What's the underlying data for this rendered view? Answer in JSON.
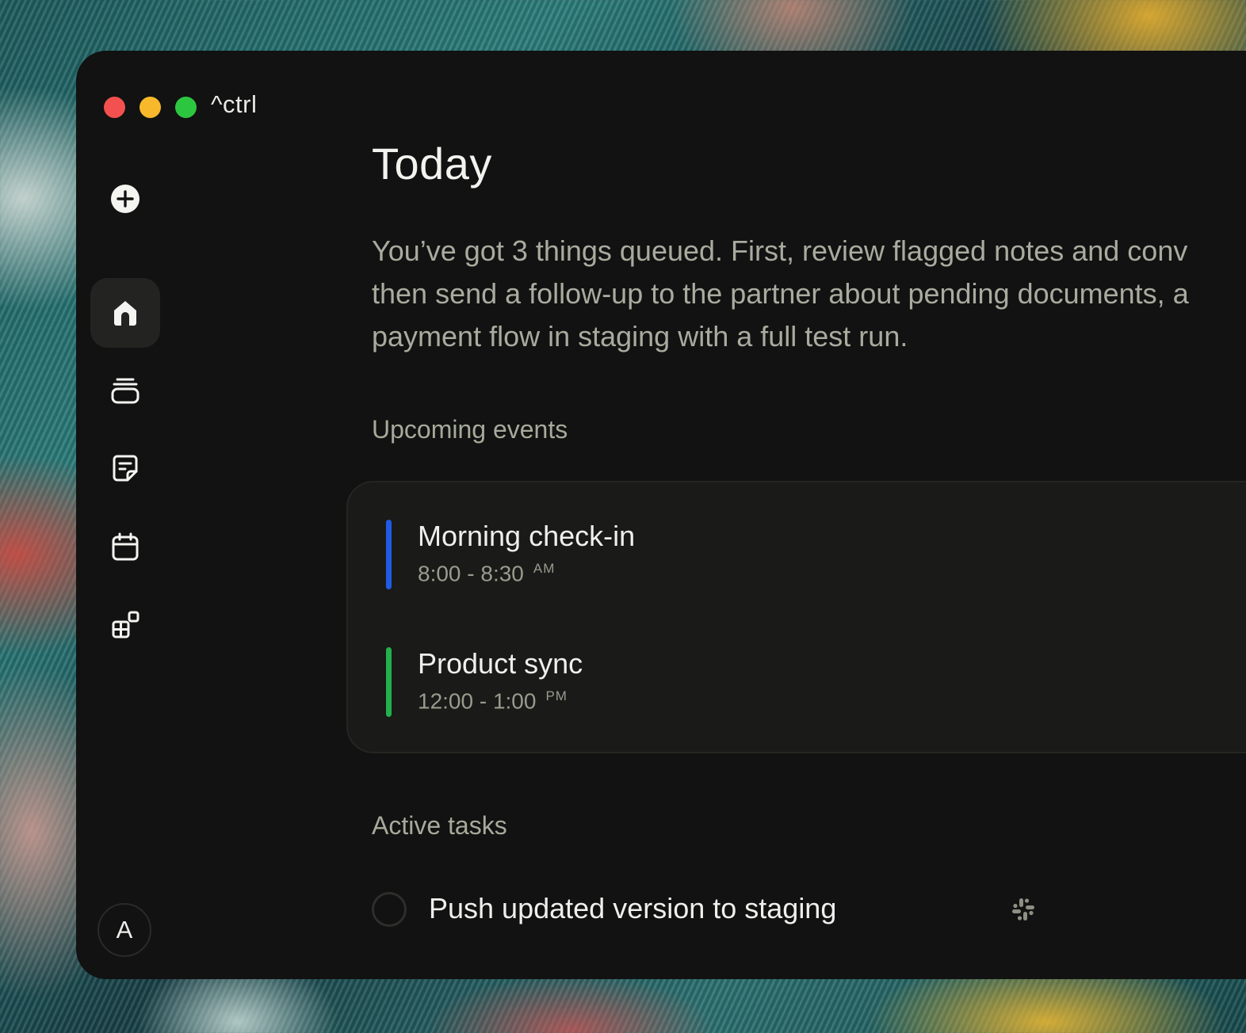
{
  "app": {
    "name": "^ctrl"
  },
  "sidebar": {
    "items": [
      {
        "name": "new",
        "icon": "plus-circle-icon"
      },
      {
        "name": "home",
        "icon": "home-icon",
        "active": true
      },
      {
        "name": "inbox",
        "icon": "stack-icon"
      },
      {
        "name": "notes",
        "icon": "note-icon"
      },
      {
        "name": "calendar",
        "icon": "calendar-icon"
      },
      {
        "name": "integrations",
        "icon": "apps-icon"
      }
    ],
    "avatar_initial": "A"
  },
  "main": {
    "title": "Today",
    "summary_lines": [
      "You’ve got 3 things queued. First, review flagged notes and conv",
      "then send a follow-up to the partner about pending documents, a",
      "payment flow in staging with a full test run."
    ],
    "upcoming": {
      "label": "Upcoming events",
      "events": [
        {
          "title": "Morning check-in",
          "time": "8:00 - 8:30",
          "period": "AM",
          "color": "#1f5be6"
        },
        {
          "title": "Product sync",
          "time": "12:00 - 1:00",
          "period": "PM",
          "color": "#22b14c"
        }
      ]
    },
    "tasks": {
      "label": "Active tasks",
      "items": [
        {
          "label": "Push updated version to staging",
          "source_icon": "slack-icon",
          "done": false
        }
      ]
    }
  },
  "colors": {
    "window_bg": "#111211",
    "card_bg": "#1a1a18",
    "traffic_red": "#f2514f",
    "traffic_yellow": "#f7b92b",
    "traffic_green": "#2dc641"
  }
}
